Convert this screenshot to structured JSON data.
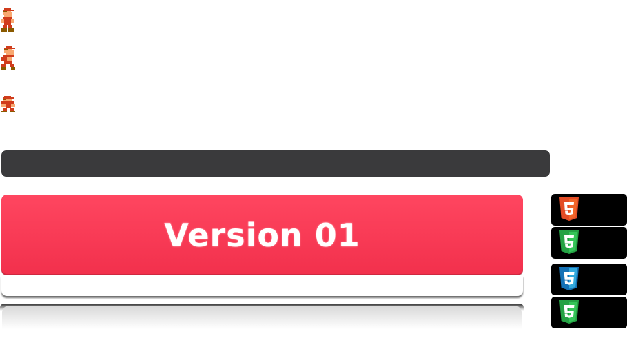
{
  "sprites": [
    {
      "icon": "mario-sprite-icon"
    },
    {
      "icon": "mario-sprite-icon"
    },
    {
      "icon": "mario-sprite-icon"
    }
  ],
  "main_button": {
    "label": "Version 01",
    "color": "#ff3a55"
  },
  "badges": [
    {
      "icon": "html5-icon",
      "color": "#e44d26"
    },
    {
      "icon": "html5-icon",
      "color": "#2bb24c"
    },
    {
      "icon": "css3-icon",
      "color": "#1572b6"
    },
    {
      "icon": "css3-icon",
      "color": "#2bb24c"
    }
  ],
  "colors": {
    "dark_bar": "#3a3a3c",
    "badge_bg": "#000000"
  }
}
